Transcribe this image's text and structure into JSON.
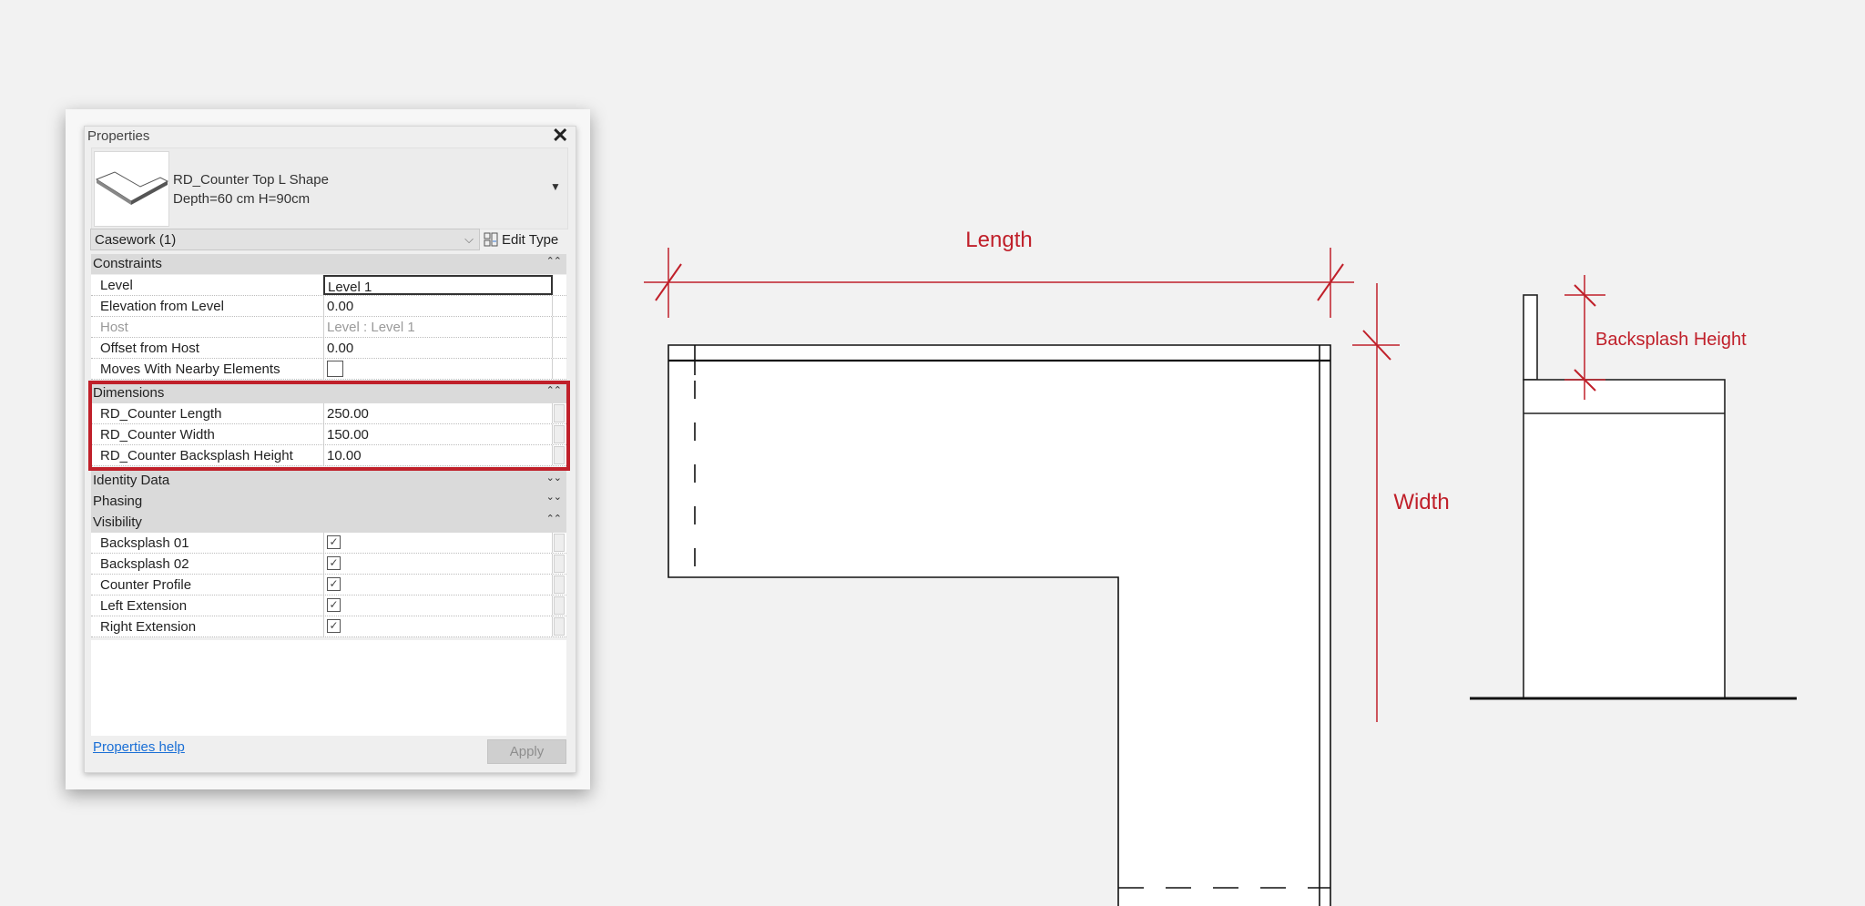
{
  "properties": {
    "title": "Properties",
    "type_name": "RD_Counter Top L Shape",
    "type_params": "Depth=60 cm H=90cm",
    "category_select": "Casework (1)",
    "edit_type_label": "Edit Type",
    "groups": {
      "constraints": {
        "label": "Constraints",
        "rows": [
          {
            "name": "Level",
            "value": "Level 1"
          },
          {
            "name": "Elevation from Level",
            "value": "0.00"
          },
          {
            "name": "Host",
            "value": "Level : Level 1"
          },
          {
            "name": "Offset from Host",
            "value": "0.00"
          },
          {
            "name": "Moves With Nearby Elements",
            "checked": false
          }
        ]
      },
      "dimensions": {
        "label": "Dimensions",
        "rows": [
          {
            "name": "RD_Counter Length",
            "value": "250.00"
          },
          {
            "name": "RD_Counter Width",
            "value": "150.00"
          },
          {
            "name": "RD_Counter Backsplash Height",
            "value": "10.00"
          }
        ]
      },
      "identity": {
        "label": "Identity Data"
      },
      "phasing": {
        "label": "Phasing"
      },
      "visibility": {
        "label": "Visibility",
        "rows": [
          {
            "name": "Backsplash 01",
            "checked": true
          },
          {
            "name": "Backsplash 02",
            "checked": true
          },
          {
            "name": "Counter Profile",
            "checked": true
          },
          {
            "name": "Left Extension",
            "checked": true
          },
          {
            "name": "Right Extension",
            "checked": true
          }
        ]
      }
    },
    "help_link": "Properties help",
    "apply_label": "Apply"
  },
  "diagram": {
    "length_label": "Length",
    "width_label": "Width",
    "backsplash_label": "Backsplash Height",
    "dimension_color": "#c0202a"
  }
}
